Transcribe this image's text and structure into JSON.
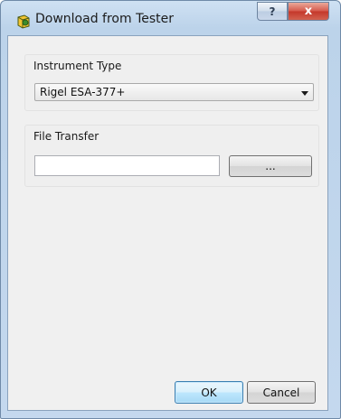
{
  "window": {
    "title": "Download from Tester",
    "icon": "instrument-app-icon",
    "help_label": "?",
    "close_label": "x"
  },
  "instrument_type": {
    "group_label": "Instrument Type",
    "selected": "Rigel ESA-377+"
  },
  "file_transfer": {
    "group_label": "File Transfer",
    "path_value": "",
    "browse_label": "..."
  },
  "buttons": {
    "ok_label": "OK",
    "cancel_label": "Cancel"
  },
  "colors": {
    "title_bar": "#c4d8ee",
    "client_bg": "#f0f0f0",
    "close_button": "#c4372a",
    "default_button": "#a7d9f5"
  }
}
